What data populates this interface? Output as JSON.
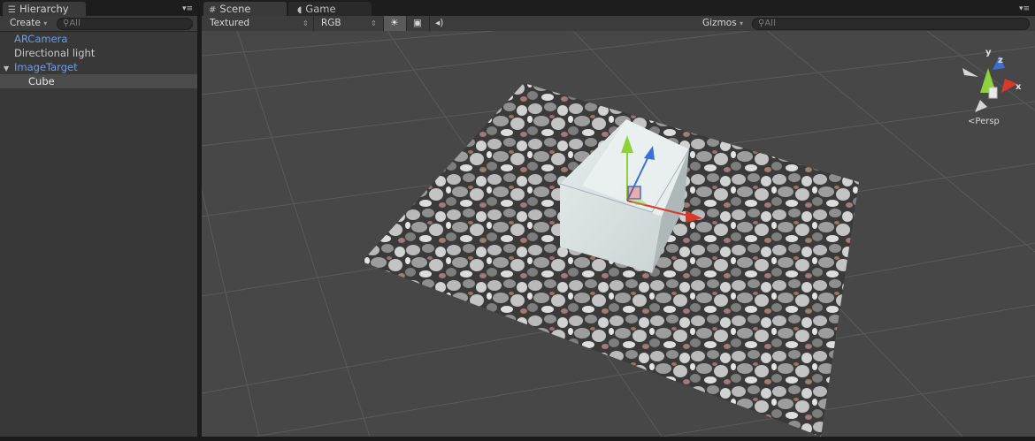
{
  "hierarchy": {
    "tab_label": "Hierarchy",
    "create_label": "Create",
    "search_placeholder": "All",
    "items": [
      {
        "label": "ARCamera"
      },
      {
        "label": "Directional light"
      },
      {
        "label": "ImageTarget"
      },
      {
        "label": "Cube"
      }
    ]
  },
  "scene": {
    "tabs": [
      {
        "label": "Scene"
      },
      {
        "label": "Game"
      }
    ],
    "render_mode": "Textured",
    "color_channel": "RGB",
    "gizmos_label": "Gizmos",
    "search_placeholder": "All",
    "gizmo": {
      "axis_x": "x",
      "axis_y": "y",
      "axis_z": "z",
      "projection": "Persp"
    }
  },
  "colors": {
    "selected_text": "#6f9ee8",
    "axis_x": "#d8392b",
    "axis_y": "#8cd23a",
    "axis_z": "#3b6fd6"
  }
}
